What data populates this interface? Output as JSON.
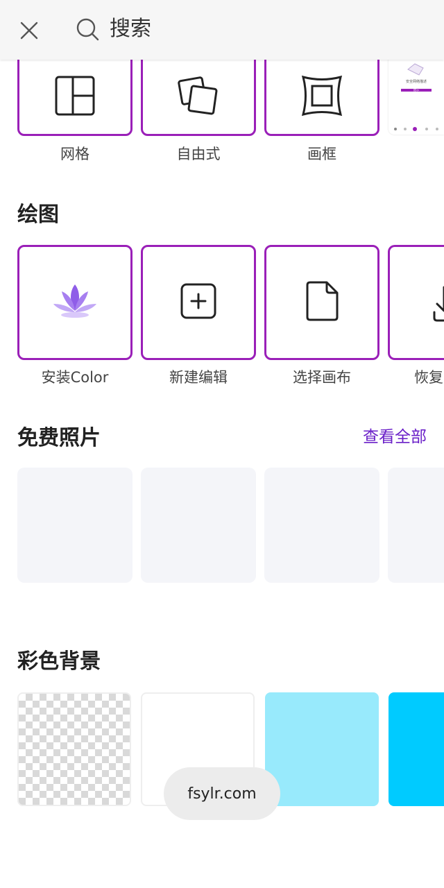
{
  "header": {
    "search_label": "搜索",
    "close_icon": "close-icon",
    "search_icon": "search-icon"
  },
  "layout_section": {
    "items": [
      {
        "label": "网格",
        "icon": "grid-icon"
      },
      {
        "label": "自由式",
        "icon": "freeform-icon"
      },
      {
        "label": "画框",
        "icon": "frame-icon"
      }
    ],
    "preview_caption": "安全网络描述",
    "preview_button": "提示"
  },
  "drawing_section": {
    "title": "绘图",
    "items": [
      {
        "label": "安装Color",
        "icon": "lotus-icon"
      },
      {
        "label": "新建编辑",
        "icon": "add-square-icon"
      },
      {
        "label": "选择画布",
        "icon": "file-icon"
      },
      {
        "label": "恢复",
        "icon": "download-icon"
      }
    ]
  },
  "photos_section": {
    "title": "免费照片",
    "see_all": "查看全部"
  },
  "backgrounds_section": {
    "title": "彩色背景",
    "colors": [
      "transparent",
      "#ffffff",
      "#98eafc",
      "#00cbff"
    ]
  },
  "colors": {
    "accent_border": "#9a1fb8",
    "link": "#6a1fc8",
    "lotus": "#8f5de8"
  },
  "toast": {
    "text": "fsylr.com"
  }
}
